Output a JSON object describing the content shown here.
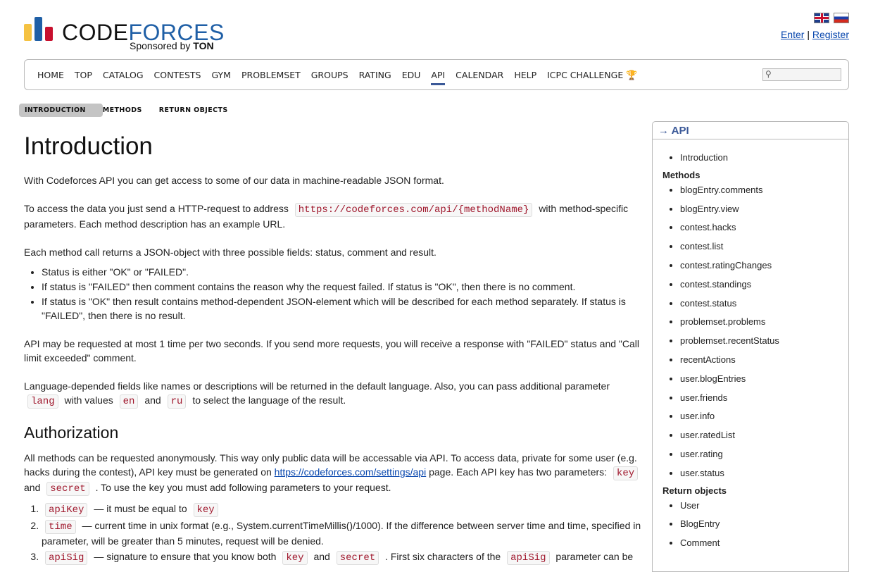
{
  "header": {
    "logo_code": "CODE",
    "logo_forces": "FORCES",
    "sponsored_by": "Sponsored by",
    "sponsor": "TON",
    "enter": "Enter",
    "separator": "|",
    "register": "Register",
    "colors": {
      "bar1": "#f5c242",
      "bar2": "#1f5fa6",
      "bar3": "#c8102e"
    }
  },
  "menu": {
    "items": [
      "HOME",
      "TOP",
      "CATALOG",
      "CONTESTS",
      "GYM",
      "PROBLEMSET",
      "GROUPS",
      "RATING",
      "EDU",
      "API",
      "CALENDAR",
      "HELP",
      "ICPC CHALLENGE"
    ],
    "active": "API",
    "trophy_icon": "trophy-icon",
    "search_icon": "magnifier-icon"
  },
  "submenu": [
    "Introduction",
    "Methods",
    "Return objects"
  ],
  "content": {
    "title": "Introduction",
    "p1": "With Codeforces API you can get access to some of our data in machine-readable JSON format.",
    "p2_a": "To access the data you just send a HTTP-request to address",
    "p2_code": "https://codeforces.com/api/{methodName}",
    "p2_b": "with method-specific parameters. Each method description has an example URL.",
    "p3": "Each method call returns a JSON-object with three possible fields: status, comment and result.",
    "bullets": [
      "Status is either \"OK\" or \"FAILED\".",
      "If status is \"FAILED\" then comment contains the reason why the request failed. If status is \"OK\", then there is no comment.",
      "If status is \"OK\" then result contains method-dependent JSON-element which will be described for each method separately. If status is \"FAILED\", then there is no result."
    ],
    "p4": "API may be requested at most 1 time per two seconds. If you send more requests, you will receive a response with \"FAILED\" status and \"Call limit exceeded\" comment.",
    "p5_a": "Language-depended fields like names or descriptions will be returned in the default language. Also, you can pass additional parameter",
    "p5_lang": "lang",
    "p5_b": "with values",
    "p5_en": "en",
    "p5_and": "and",
    "p5_ru": "ru",
    "p5_c": "to select the language of the result.",
    "auth_title": "Authorization",
    "auth_a": "All methods can be requested anonymously. This way only public data will be accessable via API. To access data, private for some user (e.g. hacks during the contest), API key must be generated on",
    "auth_link": "https://codeforces.com/settings/api",
    "auth_b": "page. Each API key has two parameters:",
    "auth_key": "key",
    "auth_and": "and",
    "auth_secret": "secret",
    "auth_c": ". To use the key you must add following parameters to your request.",
    "ol1_code": "apiKey",
    "ol1_text": "— it must be equal to",
    "ol1_key": "key",
    "ol2_code": "time",
    "ol2_text": "— current time in unix format (e.g., System.currentTimeMillis()/1000). If the difference between server time and time, specified in parameter, will be greater than 5 minutes, request will be denied.",
    "ol3_code": "apiSig",
    "ol3_a": "— signature to ensure that you know both",
    "ol3_key": "key",
    "ol3_and": "and",
    "ol3_secret": "secret",
    "ol3_b": ". First six characters of the",
    "ol3_code2": "apiSig",
    "ol3_c": "parameter can be"
  },
  "sidebar": {
    "title": "→ API",
    "intro": [
      "Introduction"
    ],
    "methods_title": "Methods",
    "methods": [
      "blogEntry.comments",
      "blogEntry.view",
      "contest.hacks",
      "contest.list",
      "contest.ratingChanges",
      "contest.standings",
      "contest.status",
      "problemset.problems",
      "problemset.recentStatus",
      "recentActions",
      "user.blogEntries",
      "user.friends",
      "user.info",
      "user.ratedList",
      "user.rating",
      "user.status"
    ],
    "objects_title": "Return objects",
    "objects": [
      "User",
      "BlogEntry",
      "Comment"
    ]
  }
}
